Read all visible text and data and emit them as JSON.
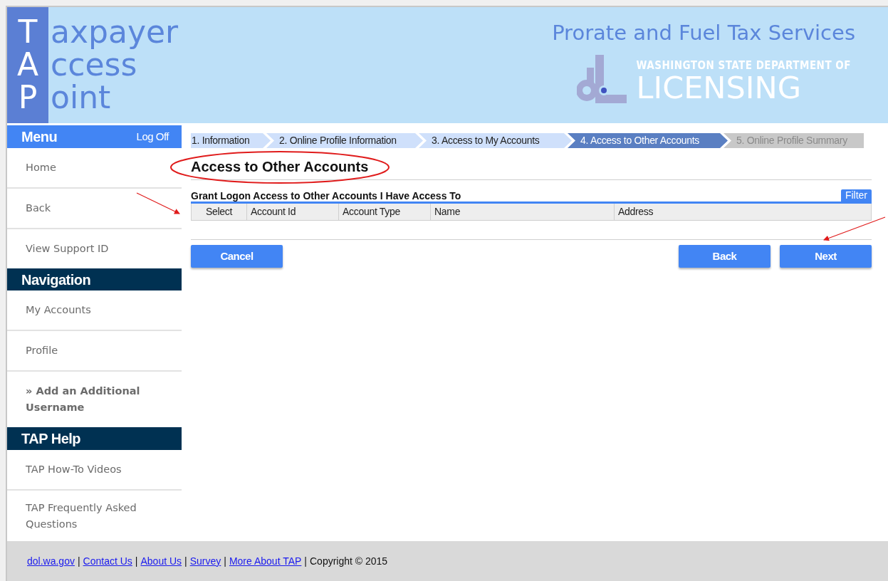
{
  "header": {
    "logo_lines": [
      {
        "initial": "T",
        "rest": "axpayer"
      },
      {
        "initial": "A",
        "rest": "ccess"
      },
      {
        "initial": "P",
        "rest": "oint"
      }
    ],
    "service_title": "Prorate and Fuel Tax Services",
    "agency_line": "WASHINGTON STATE DEPARTMENT OF",
    "agency_name": "LICENSING"
  },
  "sidebar": {
    "sections": [
      {
        "kind": "menu",
        "title": "Menu",
        "action": "Log Off",
        "items": [
          {
            "label": "Home",
            "active": false
          },
          {
            "label": "Back",
            "active": false
          },
          {
            "label": "View Support ID",
            "active": false
          }
        ]
      },
      {
        "kind": "section",
        "title": "Navigation",
        "items": [
          {
            "label": "My Accounts",
            "active": false
          },
          {
            "label": "Profile",
            "active": false
          },
          {
            "label": "» Add an Additional Username",
            "active": true
          }
        ]
      },
      {
        "kind": "section",
        "title": "TAP Help",
        "items": [
          {
            "label": "TAP How-To Videos",
            "active": false
          },
          {
            "label": "TAP Frequently Asked Questions",
            "active": false
          }
        ]
      }
    ]
  },
  "steps": [
    {
      "label": "1. Information",
      "completed": true,
      "selected": false
    },
    {
      "label": "2. Online Profile Information",
      "completed": true,
      "selected": false
    },
    {
      "label": "3. Access to My Accounts",
      "completed": true,
      "selected": false
    },
    {
      "label": "4. Access to Other Accounts",
      "completed": false,
      "selected": true
    },
    {
      "label": "5. Online Profile Summary",
      "completed": false,
      "selected": false
    }
  ],
  "page_title": "Access to Other Accounts",
  "grid": {
    "caption": "Grant Logon Access to Other Accounts I Have Access To",
    "filter": "Filter",
    "columns": [
      "Select",
      "Account Id",
      "Account Type",
      "Name",
      "Address"
    ]
  },
  "buttons": {
    "left": [
      "Cancel"
    ],
    "right": [
      "Back",
      "Next"
    ]
  },
  "footer": {
    "links": [
      "dol.wa.gov",
      "Contact Us",
      "About Us",
      "Survey",
      "More About TAP"
    ],
    "separator": "|",
    "copyright": "Copyright © 2015"
  }
}
